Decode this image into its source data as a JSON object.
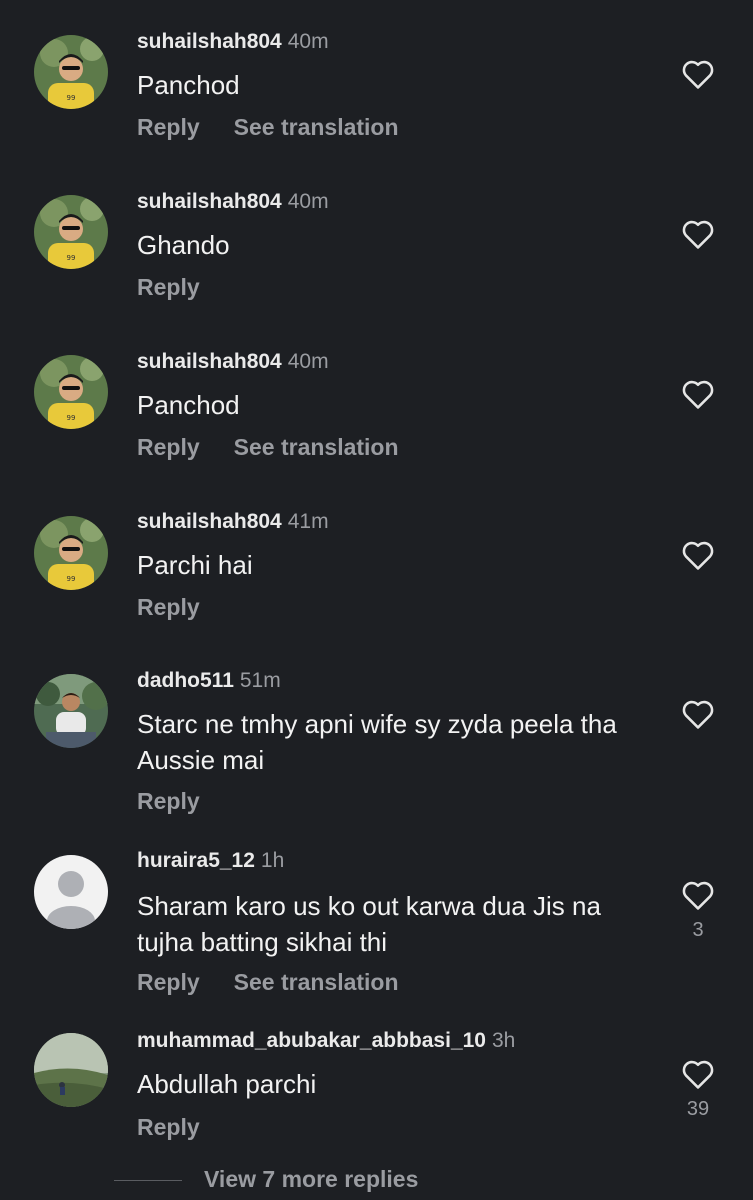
{
  "comments": [
    {
      "username": "suhailshah804",
      "time": "40m",
      "text": "Panchod",
      "reply": "Reply",
      "translate": "See translation",
      "likes": ""
    },
    {
      "username": "suhailshah804",
      "time": "40m",
      "text": "Ghando",
      "reply": "Reply",
      "likes": ""
    },
    {
      "username": "suhailshah804",
      "time": "40m",
      "text": "Panchod",
      "reply": "Reply",
      "translate": "See translation",
      "likes": ""
    },
    {
      "username": "suhailshah804",
      "time": "41m",
      "text": "Parchi hai",
      "reply": "Reply",
      "likes": ""
    },
    {
      "username": "dadho511",
      "time": "51m",
      "text": "Starc ne tmhy apni wife sy zyda peela tha Aussie mai",
      "reply": "Reply",
      "likes": ""
    },
    {
      "username": "huraira5_12",
      "time": "1h",
      "text": "Sharam karo us ko out karwa dua Jis na tujha batting sikhai thi",
      "reply": "Reply",
      "translate": "See translation",
      "likes": "3"
    },
    {
      "username": "muhammad_abubakar_abbbasi_10",
      "time": "3h",
      "text": "Abdullah parchi",
      "reply": "Reply",
      "likes": "39"
    }
  ],
  "view_more": "View 7 more replies",
  "colors": {
    "background": "#1d1f23",
    "text": "#f2f2f2",
    "muted": "#9a9ca1"
  },
  "icons": {
    "like": "heart-outline-icon",
    "default_avatar": "person-silhouette-icon"
  }
}
